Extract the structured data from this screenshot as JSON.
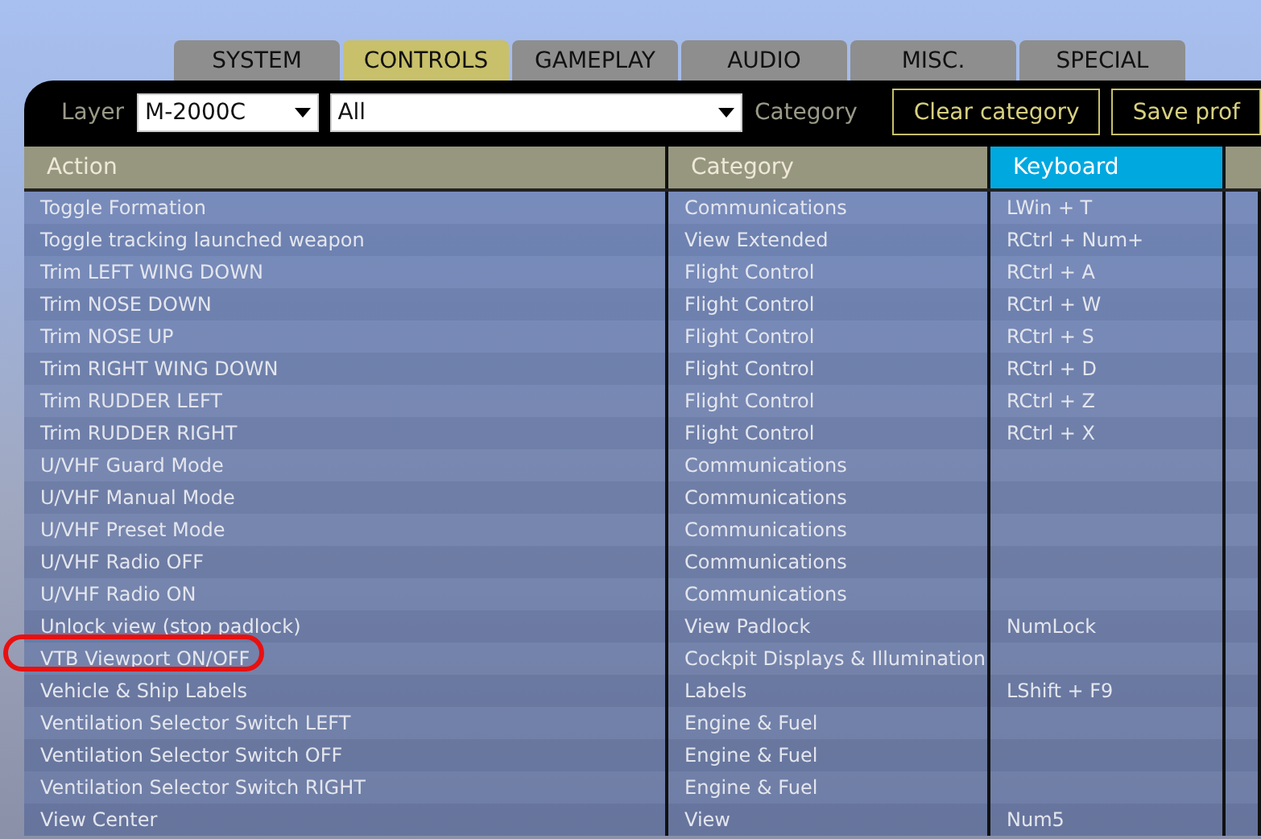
{
  "tabs": [
    {
      "label": "SYSTEM",
      "selected": false
    },
    {
      "label": "CONTROLS",
      "selected": true
    },
    {
      "label": "GAMEPLAY",
      "selected": false
    },
    {
      "label": "AUDIO",
      "selected": false
    },
    {
      "label": "MISC.",
      "selected": false
    },
    {
      "label": "SPECIAL",
      "selected": false
    }
  ],
  "toolbar": {
    "layer_label": "Layer",
    "layer_value": "M-2000C",
    "category_filter_value": "All",
    "category_label": "Category",
    "buttons": [
      "Clear category",
      "Save prof"
    ]
  },
  "table": {
    "columns": [
      {
        "label": "Action",
        "selected": false
      },
      {
        "label": "Category",
        "selected": false
      },
      {
        "label": "Keyboard",
        "selected": true
      }
    ],
    "rows": [
      [
        "Toggle Formation",
        "Communications",
        "LWin + T"
      ],
      [
        "Toggle tracking launched weapon",
        "View Extended",
        "RCtrl + Num+"
      ],
      [
        "Trim LEFT WING DOWN",
        "Flight Control",
        "RCtrl + A"
      ],
      [
        "Trim NOSE DOWN",
        "Flight Control",
        "RCtrl + W"
      ],
      [
        "Trim NOSE UP",
        "Flight Control",
        "RCtrl + S"
      ],
      [
        "Trim RIGHT WING DOWN",
        "Flight Control",
        "RCtrl + D"
      ],
      [
        "Trim RUDDER LEFT",
        "Flight Control",
        "RCtrl + Z"
      ],
      [
        "Trim RUDDER RIGHT",
        "Flight Control",
        "RCtrl + X"
      ],
      [
        "U/VHF Guard Mode",
        "Communications",
        ""
      ],
      [
        "U/VHF Manual Mode",
        "Communications",
        ""
      ],
      [
        "U/VHF Preset Mode",
        "Communications",
        ""
      ],
      [
        "U/VHF Radio OFF",
        "Communications",
        ""
      ],
      [
        "U/VHF Radio ON",
        "Communications",
        ""
      ],
      [
        "Unlock view (stop padlock)",
        "View Padlock",
        "NumLock"
      ],
      {
        "cells": [
          "VTB Viewport ON/OFF",
          "Cockpit Displays & Illumination",
          ""
        ],
        "circled": true
      },
      [
        "Vehicle & Ship Labels",
        "Labels",
        "LShift + F9"
      ],
      [
        "Ventilation Selector Switch LEFT",
        "Engine & Fuel",
        ""
      ],
      [
        "Ventilation Selector Switch OFF",
        "Engine & Fuel",
        ""
      ],
      [
        "Ventilation Selector Switch RIGHT",
        "Engine & Fuel",
        ""
      ],
      [
        "View Center",
        "View",
        "Num5"
      ]
    ]
  }
}
